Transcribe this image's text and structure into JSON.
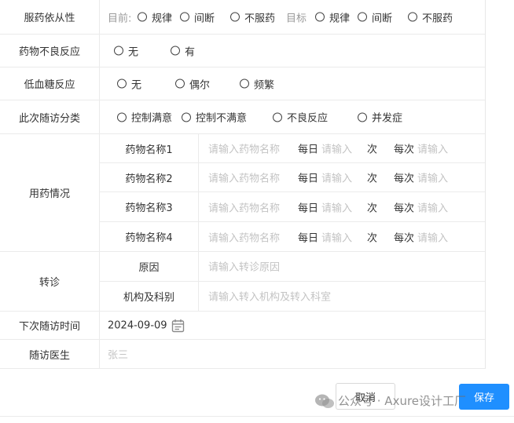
{
  "adherence": {
    "label": "服药依从性",
    "current_label": "目前:",
    "current_options": [
      "规律",
      "间断",
      "不服药"
    ],
    "target_label": "目标",
    "target_options": [
      "规律",
      "间断",
      "不服药"
    ]
  },
  "adverse_reaction": {
    "label": "药物不良反应",
    "options": [
      "无",
      "有"
    ]
  },
  "hypoglycemia": {
    "label": "低血糖反应",
    "options": [
      "无",
      "偶尔",
      "频繁"
    ]
  },
  "followup_class": {
    "label": "此次随访分类",
    "options": [
      "控制满意",
      "控制不满意",
      "不良反应",
      "并发症"
    ]
  },
  "medication": {
    "label": "用药情况",
    "drugs": [
      {
        "name_label": "药物名称1",
        "name_placeholder": "请输入药物名称",
        "daily_label": "每日",
        "daily_placeholder": "请输入",
        "times_label": "次",
        "each_label": "每次",
        "each_placeholder": "请输入"
      },
      {
        "name_label": "药物名称2",
        "name_placeholder": "请输入药物名称",
        "daily_label": "每日",
        "daily_placeholder": "请输入",
        "times_label": "次",
        "each_label": "每次",
        "each_placeholder": "请输入"
      },
      {
        "name_label": "药物名称3",
        "name_placeholder": "请输入药物名称",
        "daily_label": "每日",
        "daily_placeholder": "请输入",
        "times_label": "次",
        "each_label": "每次",
        "each_placeholder": "请输入"
      },
      {
        "name_label": "药物名称4",
        "name_placeholder": "请输入药物名称",
        "daily_label": "每日",
        "daily_placeholder": "请输入",
        "times_label": "次",
        "each_label": "每次",
        "each_placeholder": "请输入"
      }
    ]
  },
  "referral": {
    "label": "转诊",
    "reason_label": "原因",
    "reason_placeholder": "请输入转诊原因",
    "org_label": "机构及科别",
    "org_placeholder": "请输入转入机构及转入科室"
  },
  "next_visit": {
    "label": "下次随访时间",
    "value": "2024-09-09",
    "icon": "calendar-icon"
  },
  "doctor": {
    "label": "随访医生",
    "placeholder": "张三"
  },
  "buttons": {
    "cancel": "取消",
    "save": "保存"
  },
  "watermark": {
    "text": "公众号 · Axure设计工厂"
  },
  "colors": {
    "primary": "#1f8fff",
    "border": "#ebebeb",
    "placeholder": "#c3c3c3"
  }
}
